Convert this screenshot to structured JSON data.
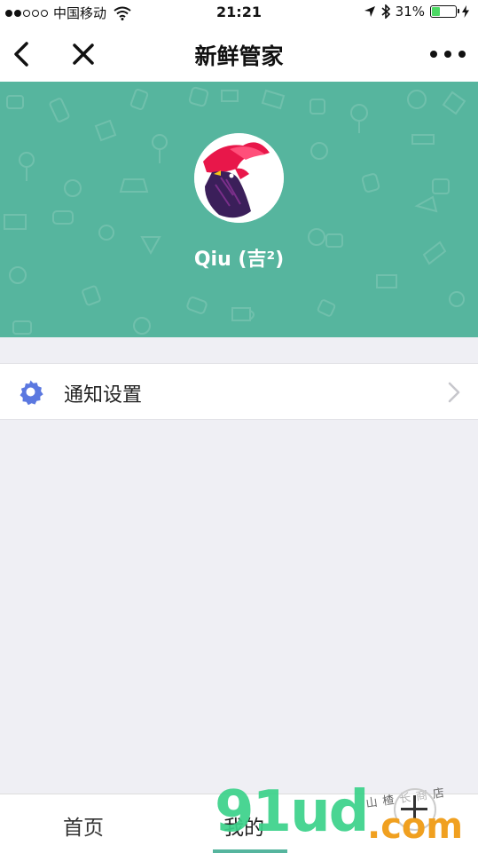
{
  "status_bar": {
    "carrier": "中国移动",
    "time": "21:21",
    "battery_percent": "31%",
    "signal_bars_filled": 2,
    "signal_bars_total": 5
  },
  "nav": {
    "title": "新鲜管家",
    "back_icon": "chevron-left-icon",
    "close_icon": "close-icon",
    "more_icon": "more-dots-icon"
  },
  "profile": {
    "username": "Qiu (吉²)",
    "header_color": "#56b59e"
  },
  "settings": {
    "items": [
      {
        "label": "通知设置",
        "icon": "gear-icon",
        "icon_color": "#5b78e0"
      }
    ]
  },
  "tabbar": {
    "home_label": "首页",
    "mine_label": "我的",
    "active_color": "#56b59e"
  },
  "watermark": {
    "brand": "91ud",
    "domain": ".com",
    "subtitle": "山楂长商店"
  }
}
